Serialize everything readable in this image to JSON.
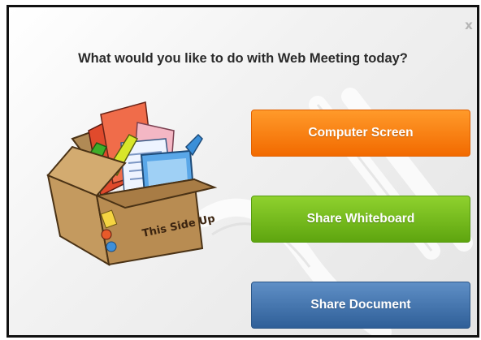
{
  "dialog": {
    "title": "What would you like to do with Web Meeting today?",
    "close_glyph": "x"
  },
  "illustration": {
    "box_label": "This Side Up"
  },
  "buttons": [
    {
      "label": "Computer Screen",
      "color": "#f57700"
    },
    {
      "label": "Share Whiteboard",
      "color": "#6cb71b"
    },
    {
      "label": "Share Document",
      "color": "#3f6fa8"
    }
  ]
}
